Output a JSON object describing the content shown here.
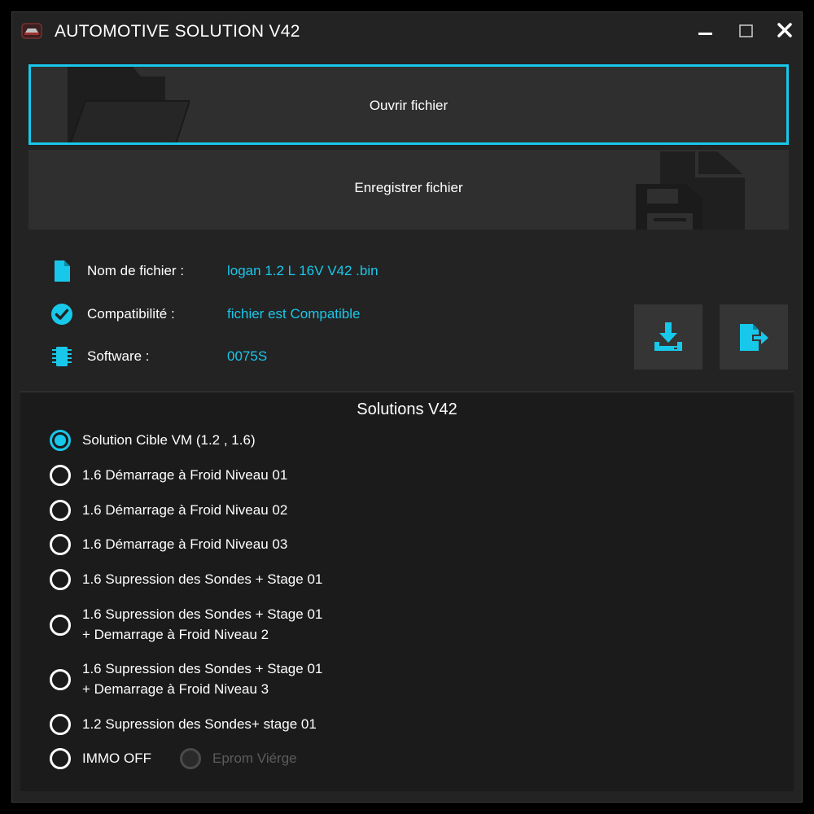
{
  "window": {
    "title": "AUTOMOTIVE SOLUTION  V42",
    "app_icon": "car-logo-icon",
    "controls": [
      "minimize-icon",
      "maximize-icon",
      "close-icon"
    ]
  },
  "actions": {
    "open_label": "Ouvrir fichier",
    "open_icon": "folder-icon",
    "save_label": "Enregistrer fichier",
    "save_icon": "floppy-disk-icon"
  },
  "file_info": {
    "filename_label": "Nom de fichier  :",
    "filename_value": "logan 1.2 L 16V V42 .bin",
    "compat_label": "Compatibilité :",
    "compat_value": "fichier est Compatible",
    "software_label": "Software :",
    "software_value": "0075S"
  },
  "side_buttons": [
    "download-icon",
    "export-file-icon"
  ],
  "solutions": {
    "title": "Solutions V42",
    "options": [
      {
        "label": "Solution Cible VM (1.2 , 1.6)",
        "checked": true
      },
      {
        "label": "1.6 Démarrage à Froid Niveau 01",
        "checked": false
      },
      {
        "label": "1.6 Démarrage à Froid Niveau 02",
        "checked": false
      },
      {
        "label": "1.6 Démarrage à Froid Niveau 03",
        "checked": false
      },
      {
        "label": "1.6 Supression des Sondes + Stage 01",
        "checked": false
      },
      {
        "label": "1.6 Supression des Sondes + Stage 01",
        "label2": "+ Demarrage à Froid Niveau 2",
        "checked": false
      },
      {
        "label": "1.6 Supression des Sondes + Stage 01",
        "label2": "+ Demarrage à Froid Niveau 3",
        "checked": false
      },
      {
        "label": "1.2 Supression des Sondes+ stage 01",
        "checked": false
      },
      {
        "label": "IMMO OFF",
        "checked": false
      }
    ],
    "eprom_label": "Eprom Viérge",
    "eprom_disabled": true
  },
  "colors": {
    "accent": "#18c8ea",
    "background": "#232323",
    "panel": "#1b1b1b",
    "button": "#2f2f2f"
  }
}
